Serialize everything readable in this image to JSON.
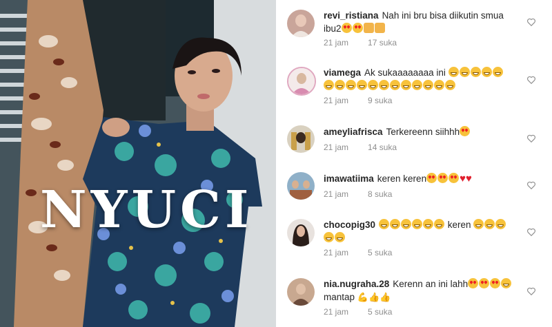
{
  "photo": {
    "overlay_word": "NYUCI"
  },
  "comments": [
    {
      "username": "revi_ristiana",
      "text": "Nah ini bru bisa diikutin smua ibu2",
      "emojis": "😍😍👏👏",
      "time": "21 jam",
      "likes": "17 suka"
    },
    {
      "username": "viamega",
      "text": "Ak sukaaaaaaaa ini",
      "emojis": "😂😂😂😂😂😂😂😂😂😂😂😂😂😂😂😂😂",
      "time": "21 jam",
      "likes": "9 suka"
    },
    {
      "username": "ameyliafrisca",
      "text": "Terkereenn siihhh",
      "emojis": "😍",
      "time": "21 jam",
      "likes": "14 suka"
    },
    {
      "username": "imawatiima",
      "text": "keren keren",
      "emojis": "😍😍😍❤️❤️",
      "time": "21 jam",
      "likes": "8 suka"
    },
    {
      "username": "chocopig30",
      "text": "keren",
      "emojis_before": "😂😂😂😂😂😂",
      "emojis": "😂😂😂😂",
      "time": "21 jam",
      "likes": "5 suka"
    },
    {
      "username": "nia.nugraha.28",
      "text": "Kerenn an ini lahh",
      "text2": "mantap",
      "emojis": "😍😍😍😂",
      "emojis2": "💪👍👍",
      "time": "21 jam",
      "likes": "5 suka"
    }
  ]
}
